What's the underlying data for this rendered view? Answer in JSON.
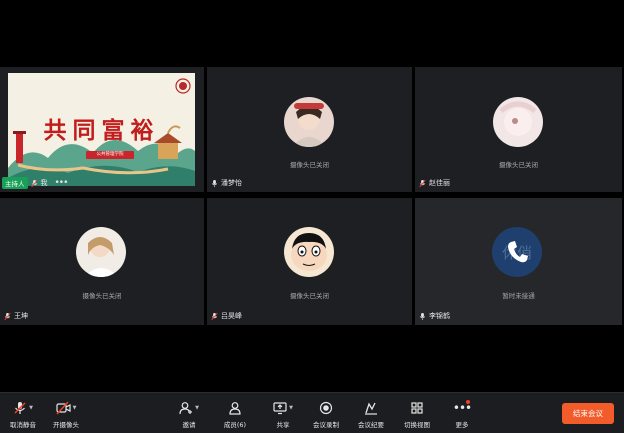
{
  "tiles": [
    {
      "name": "我",
      "host_badge": "主持人",
      "more": "•••"
    },
    {
      "name": "潘梦怡",
      "status": "摄像头已关闭"
    },
    {
      "name": "赵佳丽",
      "status": "摄像头已关闭"
    },
    {
      "name": "王坤",
      "status": "摄像头已关闭"
    },
    {
      "name": "吕昊峰",
      "status": "摄像头已关闭"
    },
    {
      "name": "李锦鹤",
      "status": "暂时未接通",
      "avatar_text": "休俏"
    }
  ],
  "slide": {
    "title": "共同富裕",
    "tag": "公共管理学院"
  },
  "toolbar": {
    "mute": "取消静音",
    "camera": "开摄像头",
    "invite": "邀请",
    "members": "成员(6)",
    "share": "共享",
    "record": "会议录制",
    "minutes": "会议纪要",
    "switch_view": "切换视图",
    "more": "更多",
    "end": "结束会议"
  },
  "colors": {
    "end_button": "#f25c2a",
    "host_badge": "#18a058",
    "call_icon_bg": "#1f3f6e"
  }
}
